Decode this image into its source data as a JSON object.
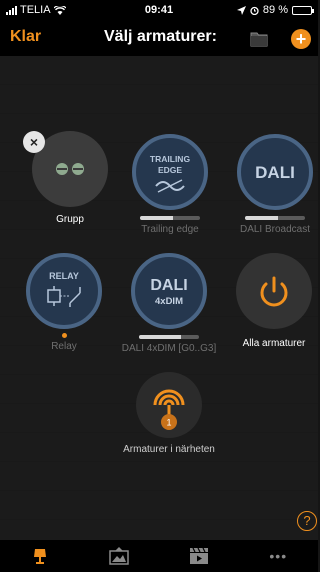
{
  "status": {
    "carrier": "TELIA",
    "time": "09:41",
    "battery": "89 %",
    "battery_level": 0.89
  },
  "nav": {
    "done": "Klar",
    "title": "Välj armaturer:",
    "add": "+"
  },
  "tiles": {
    "grupp": {
      "label": "Grupp",
      "close": "×"
    },
    "trailing": {
      "icon_line1": "TRAILING",
      "icon_line2": "EDGE",
      "label": "Trailing edge",
      "level": 0.55
    },
    "dali_broadcast": {
      "icon_text": "DALI",
      "label": "DALI Broadcast",
      "level": 0.55
    },
    "relay": {
      "icon_text": "RELAY",
      "label": "Relay"
    },
    "dali_4xdim": {
      "icon_line1": "DALI",
      "icon_line2": "4xDIM",
      "label": "DALI 4xDIM [G0..G3]",
      "level": 0.7
    },
    "alla": {
      "label": "Alla armaturer"
    },
    "nearby": {
      "label": "Armaturer i närheten",
      "count": "1"
    }
  },
  "help": "?",
  "tabbar": {
    "more": "•••"
  },
  "colors": {
    "accent": "#f0901e",
    "ring": "#4a6585",
    "ring_dark": "#2c4560"
  }
}
